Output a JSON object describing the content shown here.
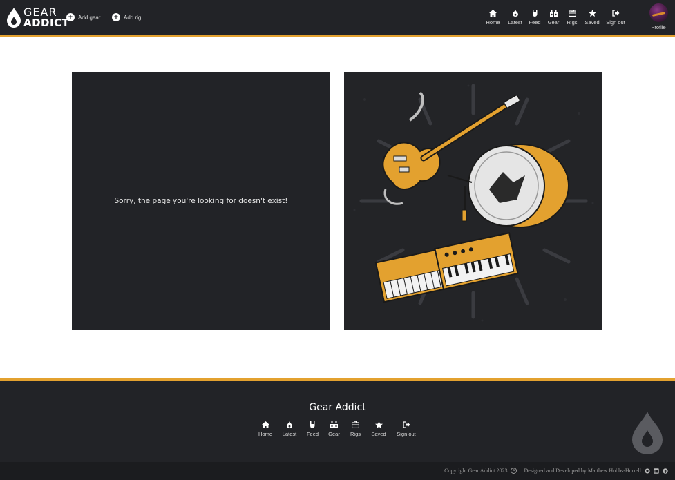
{
  "brand": {
    "line1": "GEAR",
    "line2": "ADDICT"
  },
  "header": {
    "add_gear": "Add gear",
    "add_rig": "Add rig",
    "nav": [
      {
        "label": "Home",
        "icon": "home-icon"
      },
      {
        "label": "Latest",
        "icon": "flame-icon"
      },
      {
        "label": "Feed",
        "icon": "rock-hand-icon"
      },
      {
        "label": "Gear",
        "icon": "amplifier-icon"
      },
      {
        "label": "Rigs",
        "icon": "case-icon"
      },
      {
        "label": "Saved",
        "icon": "star-icon"
      },
      {
        "label": "Sign out",
        "icon": "sign-out-icon"
      }
    ],
    "profile_label": "Profile"
  },
  "main": {
    "not_found_message": "Sorry, the page you're looking for doesn't exist!"
  },
  "footer": {
    "title": "Gear Addict",
    "nav": [
      {
        "label": "Home",
        "icon": "home-icon"
      },
      {
        "label": "Latest",
        "icon": "flame-icon"
      },
      {
        "label": "Feed",
        "icon": "rock-hand-icon"
      },
      {
        "label": "Gear",
        "icon": "amplifier-icon"
      },
      {
        "label": "Rigs",
        "icon": "case-icon"
      },
      {
        "label": "Saved",
        "icon": "star-icon"
      },
      {
        "label": "Sign out",
        "icon": "sign-out-icon"
      }
    ],
    "copyright": "Copyright Gear Addict 2023",
    "credit": "Designed and Developed by Matthew Hobbs-Hurrell",
    "social_icons": [
      "github-icon",
      "linkedin-icon",
      "facebook-icon"
    ]
  },
  "colors": {
    "dark": "#222327",
    "accent": "#e3a12f",
    "text": "#ffffff"
  }
}
